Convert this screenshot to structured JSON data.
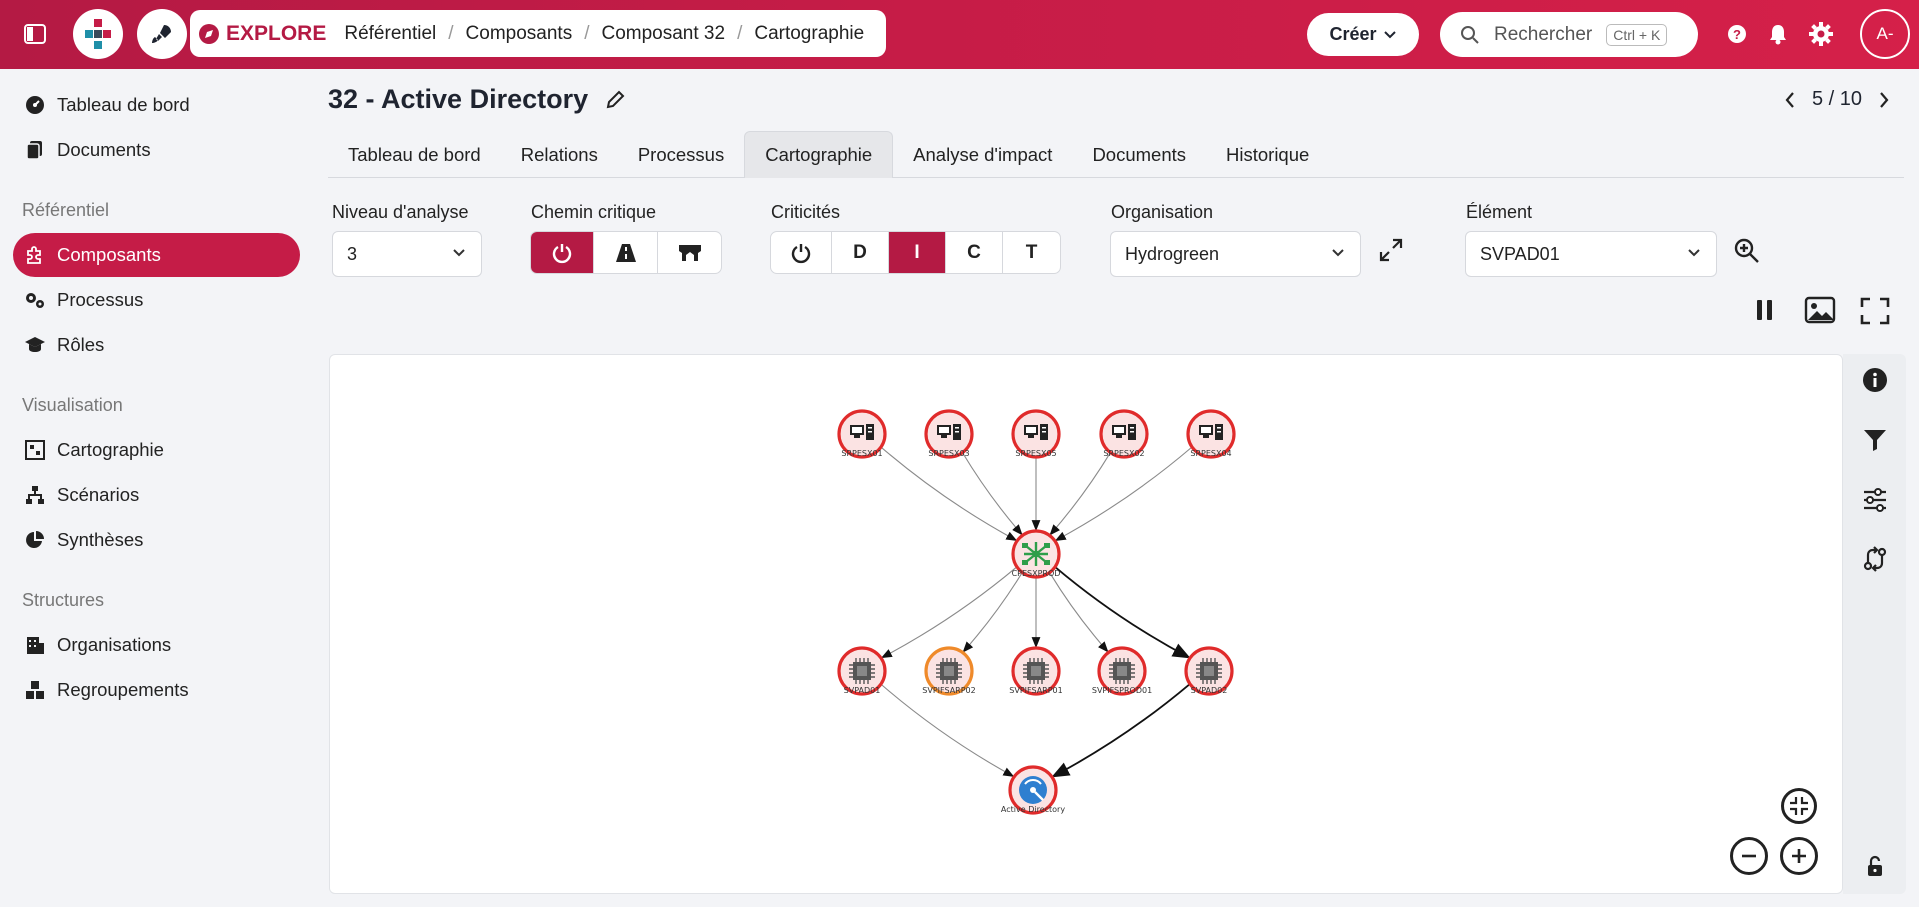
{
  "topbar": {
    "explore_label": "EXPLORE",
    "breadcrumb": [
      "Référentiel",
      "Composants",
      "Composant 32",
      "Cartographie"
    ],
    "create_label": "Créer",
    "search_placeholder": "Rechercher",
    "search_shortcut": "Ctrl + K",
    "avatar_initials": "A-"
  },
  "sidebar": {
    "top_items": [
      "Tableau de bord",
      "Documents"
    ],
    "sections": [
      {
        "title": "Référentiel",
        "items": [
          "Composants",
          "Processus",
          "Rôles"
        ]
      },
      {
        "title": "Visualisation",
        "items": [
          "Cartographie",
          "Scénarios",
          "Synthèses"
        ]
      },
      {
        "title": "Structures",
        "items": [
          "Organisations",
          "Regroupements"
        ]
      }
    ],
    "active_item": "Composants"
  },
  "page": {
    "title": "32 - Active Directory",
    "pager": "5 / 10",
    "tabs": [
      "Tableau de bord",
      "Relations",
      "Processus",
      "Cartographie",
      "Analyse d'impact",
      "Documents",
      "Historique"
    ],
    "active_tab": "Cartographie"
  },
  "filters": {
    "niveau_label": "Niveau d'analyse",
    "niveau_value": "3",
    "chemin_label": "Chemin critique",
    "criticites_label": "Criticités",
    "criticites_buttons": [
      "D",
      "I",
      "C",
      "T"
    ],
    "criticites_active": "I",
    "organisation_label": "Organisation",
    "organisation_value": "Hydrogreen",
    "element_label": "Élément",
    "element_value": "SVPAD01"
  },
  "graph": {
    "nodes": [
      {
        "id": "SRPESX01",
        "label": "SRPESX01",
        "kind": "server",
        "ring": "#e02b2b"
      },
      {
        "id": "SRPESX03",
        "label": "SRPESX03",
        "kind": "server",
        "ring": "#e02b2b"
      },
      {
        "id": "SRPESX05",
        "label": "SRPESX05",
        "kind": "server",
        "ring": "#e02b2b"
      },
      {
        "id": "SRPESX02",
        "label": "SRPESX02",
        "kind": "server",
        "ring": "#e02b2b"
      },
      {
        "id": "SRPESX04",
        "label": "SRPESX04",
        "kind": "server",
        "ring": "#e02b2b"
      },
      {
        "id": "CPESXPROD",
        "label": "CPESXPROD",
        "kind": "cluster",
        "ring": "#e02b2b"
      },
      {
        "id": "SVPAD01",
        "label": "SVPAD01",
        "kind": "vm",
        "ring": "#e02b2b"
      },
      {
        "id": "SVPIFSARP02",
        "label": "SVPIFSARP02",
        "kind": "vm",
        "ring": "#ef8a2a"
      },
      {
        "id": "SVPIFSARP01",
        "label": "SVPIFSARP01",
        "kind": "vm",
        "ring": "#e02b2b"
      },
      {
        "id": "SVPIFSPROD01",
        "label": "SVPIFSPROD01",
        "kind": "vm",
        "ring": "#e02b2b"
      },
      {
        "id": "SVPAD02",
        "label": "SVPAD02",
        "kind": "vm",
        "ring": "#e02b2b"
      },
      {
        "id": "ActiveDirectory",
        "label": "Active Directory",
        "kind": "app",
        "ring": "#e02b2b"
      }
    ]
  },
  "colors": {
    "brand": "#c51c47",
    "brand_dark": "#b41a44"
  }
}
